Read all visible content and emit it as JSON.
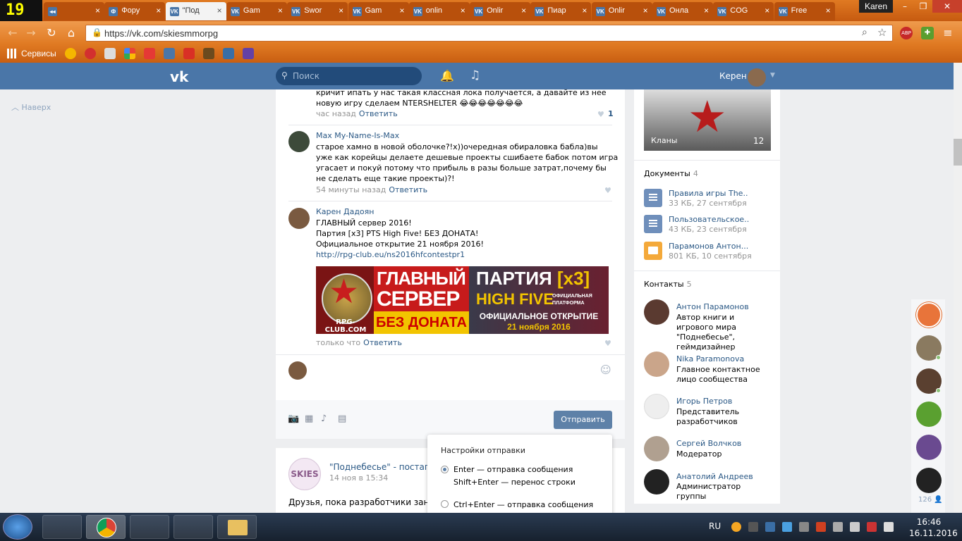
{
  "browser": {
    "badge": "19",
    "tabs": [
      {
        "label": "",
        "fav": "◂◂"
      },
      {
        "label": "Фору",
        "fav": "Ф"
      },
      {
        "label": "\"Под",
        "fav": "VK",
        "active": true
      },
      {
        "label": "Gam",
        "fav": "VK"
      },
      {
        "label": "Swor",
        "fav": "VK"
      },
      {
        "label": "Gam",
        "fav": "VK"
      },
      {
        "label": "onlin",
        "fav": "VK"
      },
      {
        "label": "Onlir",
        "fav": "VK"
      },
      {
        "label": "Пиар",
        "fav": "VK"
      },
      {
        "label": "Onlir",
        "fav": "VK"
      },
      {
        "label": "Онла",
        "fav": "VK"
      },
      {
        "label": "COG",
        "fav": "VK"
      },
      {
        "label": "Free",
        "fav": "VK"
      }
    ],
    "window_user": "Karen",
    "url": "https://vk.com/skiesmmorpg",
    "bookmarks_label": "Сервисы"
  },
  "vk_header": {
    "search_placeholder": "Поиск",
    "user_name": "Керен"
  },
  "up_link": "Наверх",
  "comments": [
    {
      "text_lines": [
        "кричит ипать у нас такая классная лока получается, а давайте из нее",
        "новую игру сделаем NTERSHELTER 😂😂😂😂😂😂😂"
      ],
      "time": "час назад",
      "reply": "Ответить",
      "likes": "1"
    },
    {
      "author": "Max My-Name-Is-Max",
      "text_lines": [
        "старое хамно в новой оболочке?!х))очередная обираловка бабла)вы",
        "уже как корейцы делаете дешевые проекты сшибаете бабок потом игра",
        "угасает и покуй потому что прибыль в разы больше затрат,почему бы",
        "не сделать еще такие проекты)?!"
      ],
      "time": "54 минуты назад",
      "reply": "Ответить"
    },
    {
      "author": "Карен Дадоян",
      "text_lines": [
        "ГЛАВНЫЙ сервер 2016!",
        "Партия [x3] PTS High Five! БЕЗ ДОНАТА!",
        "Официальное открытие 21 ноября 2016!"
      ],
      "link": "http://rpg-club.eu/ns2016hfcontestpr1",
      "time": "только что",
      "reply": "Ответить"
    }
  ],
  "banner": {
    "site": "RPG-CLUB.COM",
    "g1": "ГЛАВНЫЙ",
    "g2": "СЕРВЕР",
    "g3": "БЕЗ ДОНАТА",
    "p1": "ПАРТИЯ",
    "p1b": "[x3]",
    "p2": "HIGH FIVE",
    "p2s": "ОФИЦИАЛЬНАЯ ПЛАТФОРМА",
    "p3a": "ОФИЦИАЛЬНОЕ ОТКРЫТИЕ",
    "p3b": "21 ноября 2016"
  },
  "composer": {
    "send_label": "Отправить"
  },
  "send_settings": {
    "title": "Настройки отправки",
    "opt1_a": "Enter — отправка сообщения",
    "opt1_b": "Shift+Enter — перенос строки",
    "opt2": "Ctrl+Enter — отправка сообщения"
  },
  "post2": {
    "avatar_text": "SKIES",
    "name": "\"Поднебесье\" - постапок",
    "date": "14 ноя в 15:34",
    "text": "Друзья, пока разработчики заним                                          "
  },
  "right": {
    "clans_label": "Кланы",
    "clans_count": "12",
    "docs_title": "Документы",
    "docs_count": "4",
    "docs": [
      {
        "name": "Правила игры The..",
        "meta": "33 КБ, 27 сентября"
      },
      {
        "name": "Пользовательское..",
        "meta": "43 КБ, 23 сентября"
      },
      {
        "name": "Парамонов Антон...",
        "meta": "801 КБ, 10 сентября"
      }
    ],
    "contacts_title": "Контакты",
    "contacts_count": "5",
    "contacts": [
      {
        "name": "Антон Парамонов",
        "role": "Автор книги и игрового мира \"Поднебесье\", геймдизайнер"
      },
      {
        "name": "Nika Paramonova",
        "role": "Главное контактное лицо сообщества"
      },
      {
        "name": "Игорь Петров",
        "role": "Представитель разработчиков"
      },
      {
        "name": "Сергей Волчков",
        "role": "Модератор"
      },
      {
        "name": "Анатолий Андреев",
        "role": "Администратор группы"
      }
    ]
  },
  "chat_count": "126",
  "taskbar": {
    "lang": "RU",
    "time": "16:46",
    "date": "16.11.2016"
  }
}
